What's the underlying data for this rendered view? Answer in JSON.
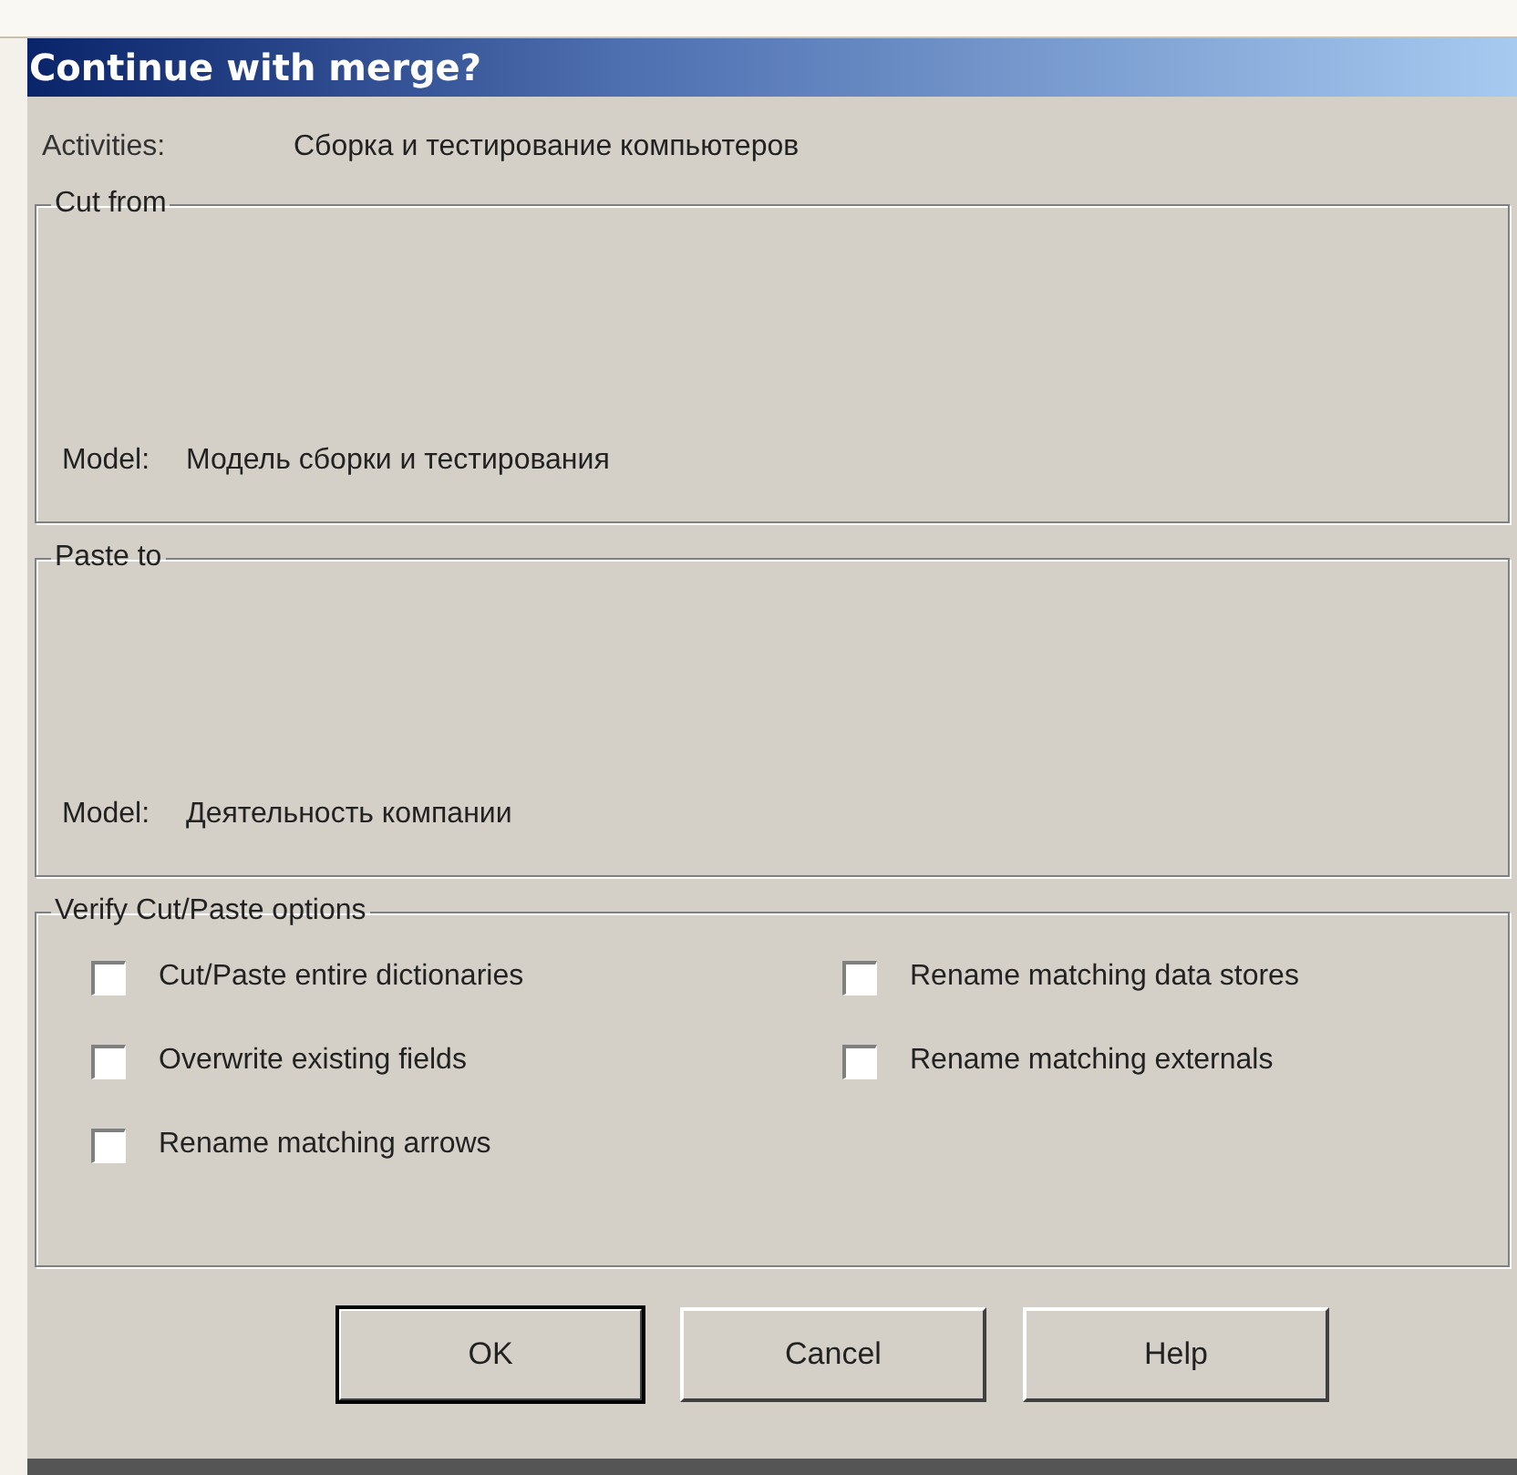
{
  "window": {
    "title": "Continue with merge?"
  },
  "activities": {
    "label": "Activities:",
    "value": "Сборка и тестирование  компьютеров"
  },
  "groups": [
    {
      "title": "Cut from",
      "model_label": "Model:",
      "model_value": "Модель сборки и тестирования"
    },
    {
      "title": "Paste to",
      "model_label": "Model:",
      "model_value": "Деятельность компании"
    }
  ],
  "options": {
    "title": "Verify Cut/Paste options",
    "items": [
      {
        "label": "Cut/Paste entire dictionaries",
        "checked": false
      },
      {
        "label": "Rename matching data stores",
        "checked": false
      },
      {
        "label": "Overwrite existing fields",
        "checked": false
      },
      {
        "label": "Rename matching externals",
        "checked": false
      },
      {
        "label": "Rename matching arrows",
        "checked": false
      }
    ]
  },
  "buttons": [
    {
      "label": "OK",
      "default": true
    },
    {
      "label": "Cancel",
      "default": false
    },
    {
      "label": "Help",
      "default": false
    }
  ]
}
